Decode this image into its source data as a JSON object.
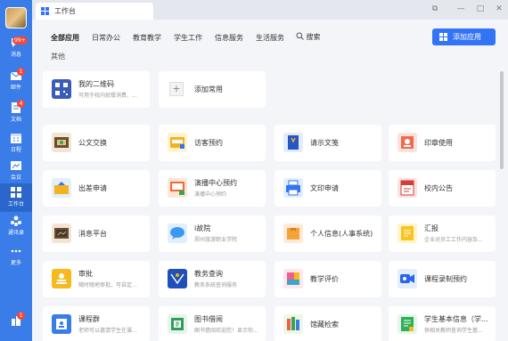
{
  "nav": {
    "items": [
      {
        "label": "消息",
        "icon": "chat-icon",
        "badge": "99+"
      },
      {
        "label": "邮件",
        "icon": "mail-icon",
        "badge": "1"
      },
      {
        "label": "文档",
        "icon": "document-icon",
        "badge": "4"
      },
      {
        "label": "日程",
        "icon": "calendar-icon",
        "badge": ""
      },
      {
        "label": "会议",
        "icon": "meeting-icon",
        "badge": ""
      },
      {
        "label": "工作台",
        "icon": "workbench-icon",
        "badge": ""
      },
      {
        "label": "通讯录",
        "icon": "contacts-icon",
        "badge": ""
      },
      {
        "label": "更多",
        "icon": "more-icon",
        "badge": ""
      }
    ],
    "bottom_badge": "1"
  },
  "window": {
    "tab_title": "工作台"
  },
  "categories": [
    "全部应用",
    "日常办公",
    "教育教学",
    "学生工作",
    "信息服务",
    "生活服务"
  ],
  "search_label": "搜索",
  "add_app_label": "添加应用",
  "other_label": "其他",
  "top_cards": [
    {
      "title": "我的二维码",
      "subtitle": "可用于校内就餐消费、..."
    },
    {
      "title": "添加常用",
      "subtitle": ""
    }
  ],
  "apps": [
    {
      "title": "公文交换",
      "subtitle": ""
    },
    {
      "title": "访客预约",
      "subtitle": ""
    },
    {
      "title": "请示文笺",
      "subtitle": ""
    },
    {
      "title": "印章使用",
      "subtitle": ""
    },
    {
      "title": "出差申请",
      "subtitle": ""
    },
    {
      "title": "演播中心预约",
      "subtitle": "演播中心预约"
    },
    {
      "title": "文印申请",
      "subtitle": ""
    },
    {
      "title": "校内公告",
      "subtitle": ""
    },
    {
      "title": "消息平台",
      "subtitle": ""
    },
    {
      "title": "i故院",
      "subtitle": "郑州旅游职业学院"
    },
    {
      "title": "个人信息(人事系统)",
      "subtitle": ""
    },
    {
      "title": "汇报",
      "subtitle": "企业对员工工作内容及..."
    },
    {
      "title": "审批",
      "subtitle": "随时随地审批，可自定..."
    },
    {
      "title": "教务查询",
      "subtitle": "教务系统查询服务"
    },
    {
      "title": "教学评价",
      "subtitle": ""
    },
    {
      "title": "课程录制预约",
      "subtitle": ""
    },
    {
      "title": "课程群",
      "subtitle": "老师可以邀请学生在课..."
    },
    {
      "title": "图书借阅",
      "subtitle": "图书借阅欢迎您！显示你..."
    },
    {
      "title": "馆藏检索",
      "subtitle": ""
    },
    {
      "title": "学生基本信息（学...",
      "subtitle": "供相关教师查询学生基..."
    }
  ]
}
